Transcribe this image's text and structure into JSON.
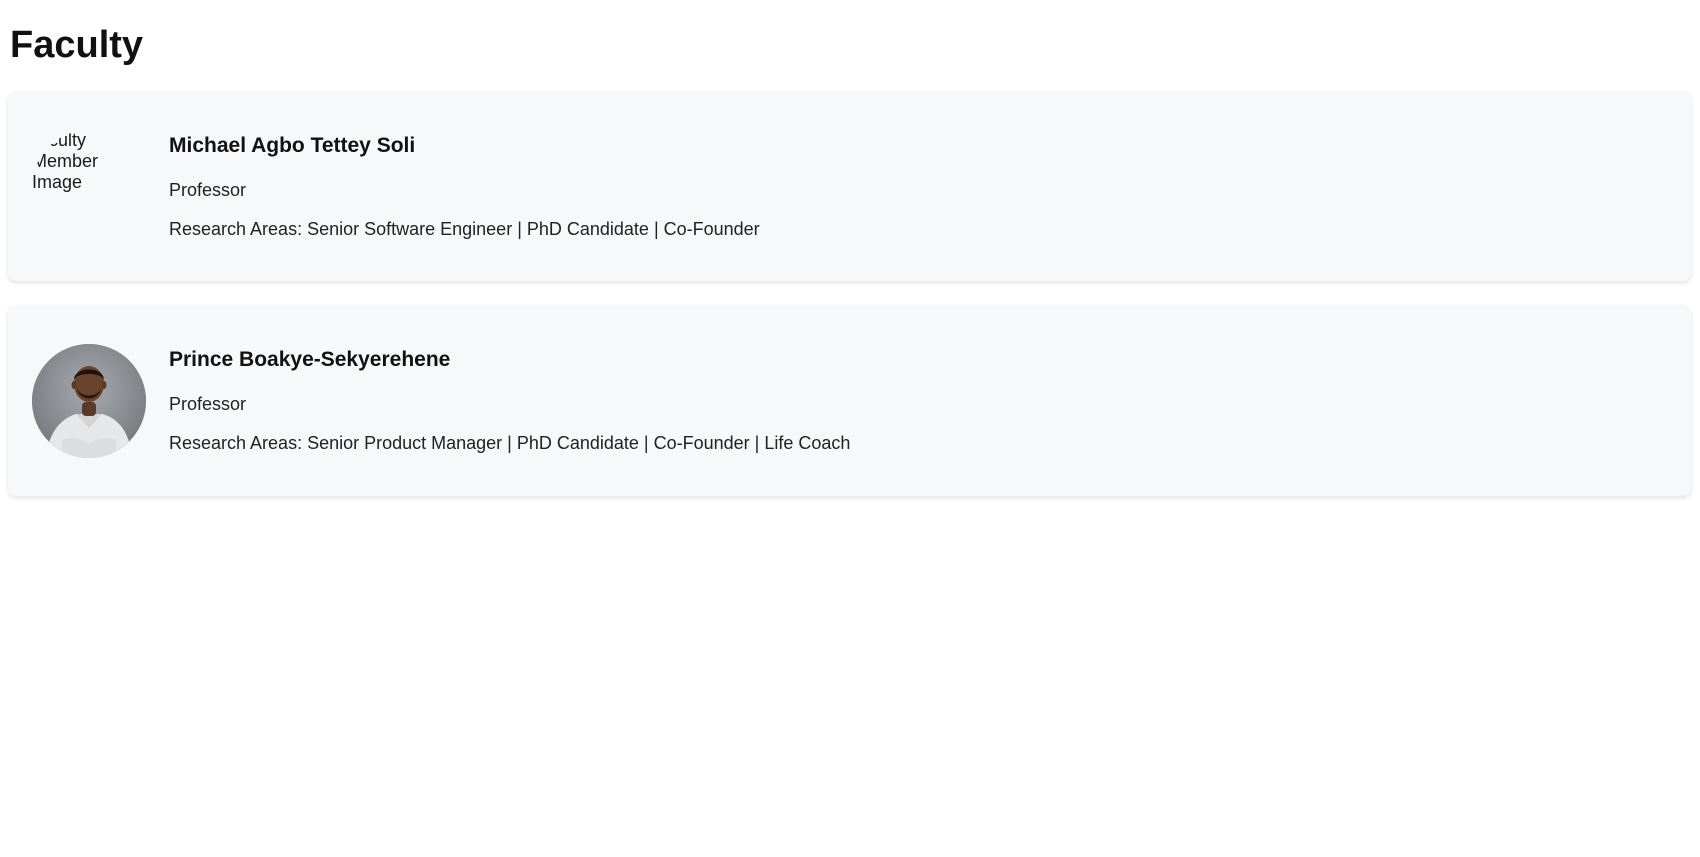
{
  "page": {
    "title": "Faculty"
  },
  "faculty": [
    {
      "name": "Michael Agbo Tettey Soli",
      "role": "Professor",
      "research_areas": "Research Areas: Senior Software Engineer | PhD Candidate | Co-Founder",
      "image_alt": "Faculty Member Image"
    },
    {
      "name": "Prince Boakye-Sekyerehene",
      "role": "Professor",
      "research_areas": "Research Areas: Senior Product Manager | PhD Candidate | Co-Founder | Life Coach"
    }
  ],
  "colors": {
    "card_background": "#f7f8fa",
    "text": "#1a1a1a"
  }
}
